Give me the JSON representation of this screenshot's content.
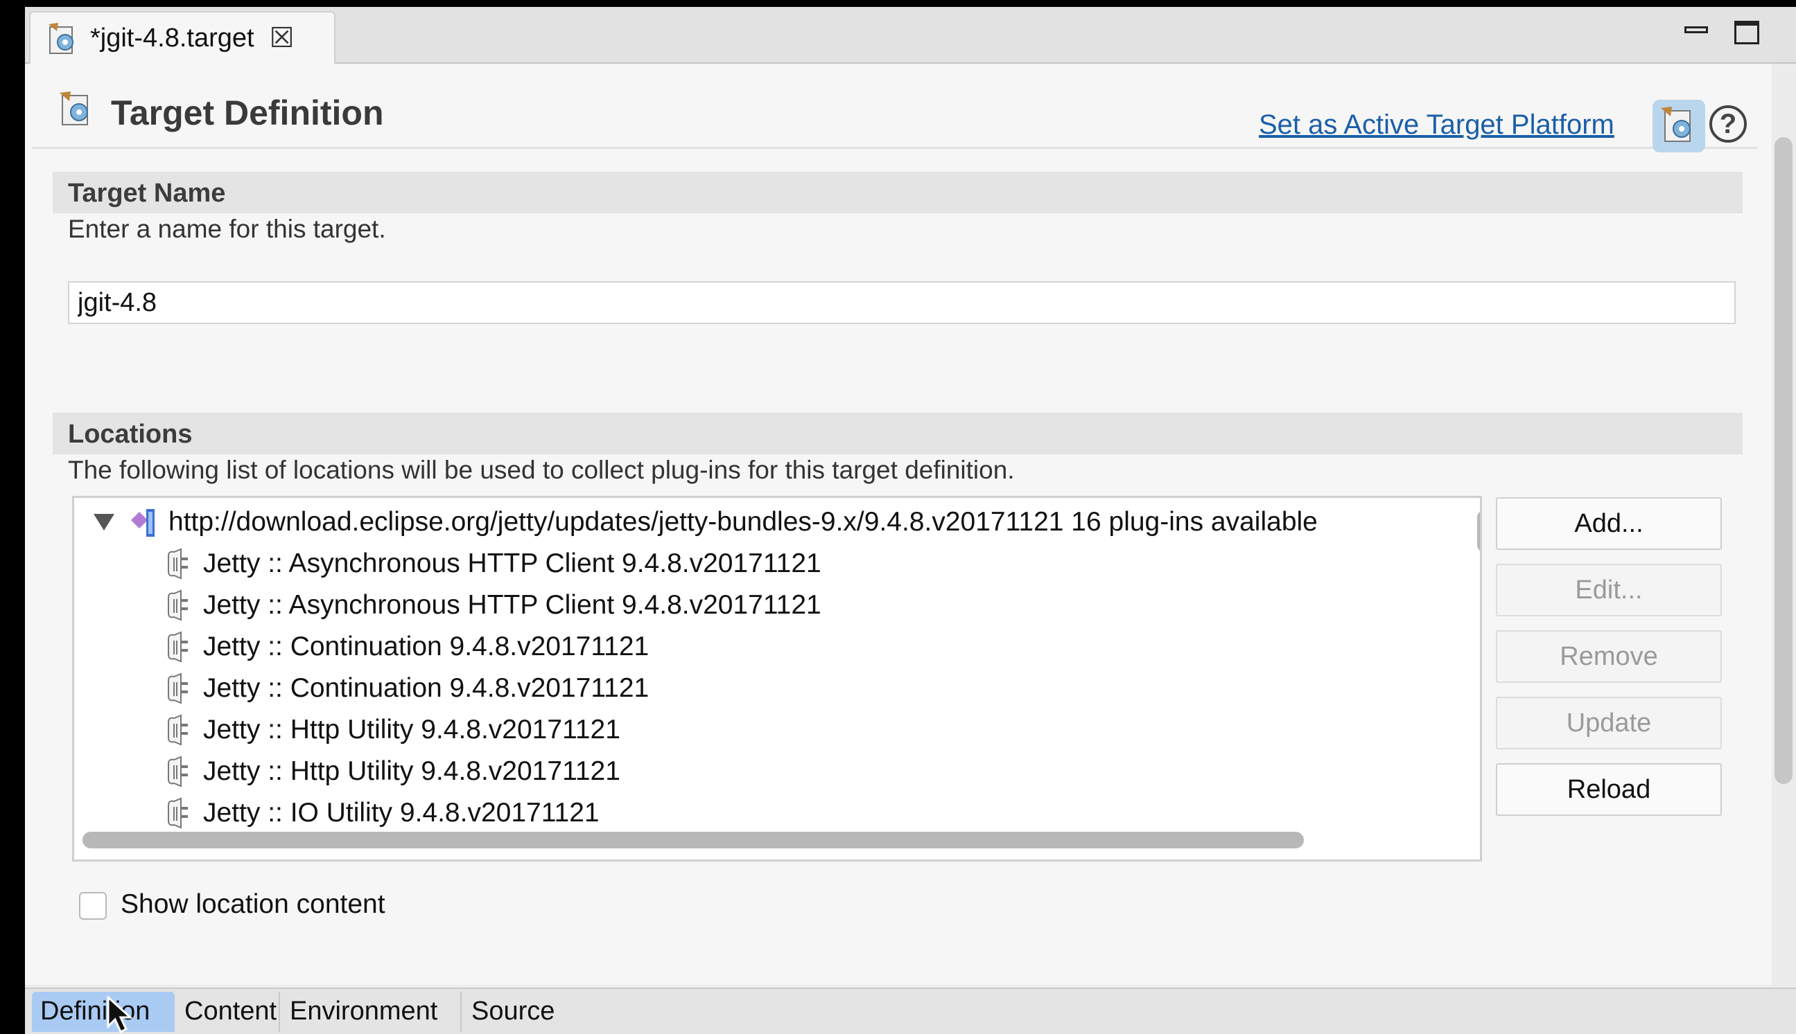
{
  "editor_tab": {
    "label": "*jgit-4.8.target",
    "icon": "target-file-icon",
    "close_icon": "close-icon",
    "close_glyph": "☒"
  },
  "window_controls": {
    "minimize_icon": "minimize-icon",
    "maximize_icon": "maximize-icon"
  },
  "header": {
    "title": "Target Definition",
    "icon": "target-definition-icon",
    "active_link": "Set as Active Target Platform",
    "help_glyph": "?",
    "link_color": "#1a5fa8"
  },
  "target_name": {
    "section_title": "Target Name",
    "description": "Enter a name for this target.",
    "value": "jgit-4.8"
  },
  "locations": {
    "section_title": "Locations",
    "description": "The following list of locations will be used to collect plug-ins for this target definition.",
    "tree": {
      "root": {
        "label": "http://download.eclipse.org/jetty/updates/jetty-bundles-9.x/9.4.8.v20171121 16 plug-ins available",
        "expanded": true,
        "icon": "software-site-icon"
      },
      "children": [
        "Jetty :: Asynchronous HTTP Client 9.4.8.v20171121",
        "Jetty :: Asynchronous HTTP Client 9.4.8.v20171121",
        "Jetty :: Continuation 9.4.8.v20171121",
        "Jetty :: Continuation 9.4.8.v20171121",
        "Jetty :: Http Utility 9.4.8.v20171121",
        "Jetty :: Http Utility 9.4.8.v20171121",
        "Jetty :: IO Utility 9.4.8.v20171121"
      ],
      "child_icon": "plugin-bundle-icon"
    },
    "buttons": [
      {
        "label": "Add...",
        "enabled": true
      },
      {
        "label": "Edit...",
        "enabled": false
      },
      {
        "label": "Remove",
        "enabled": false
      },
      {
        "label": "Update",
        "enabled": false
      },
      {
        "label": "Reload",
        "enabled": true
      }
    ],
    "show_content": {
      "label": "Show location content",
      "checked": false
    }
  },
  "page_tabs": [
    {
      "label": "Definition",
      "active": true
    },
    {
      "label": "Content",
      "active": false
    },
    {
      "label": "Environment",
      "active": false
    },
    {
      "label": "Source",
      "active": false
    }
  ],
  "accent_color": "#a9cbf3"
}
